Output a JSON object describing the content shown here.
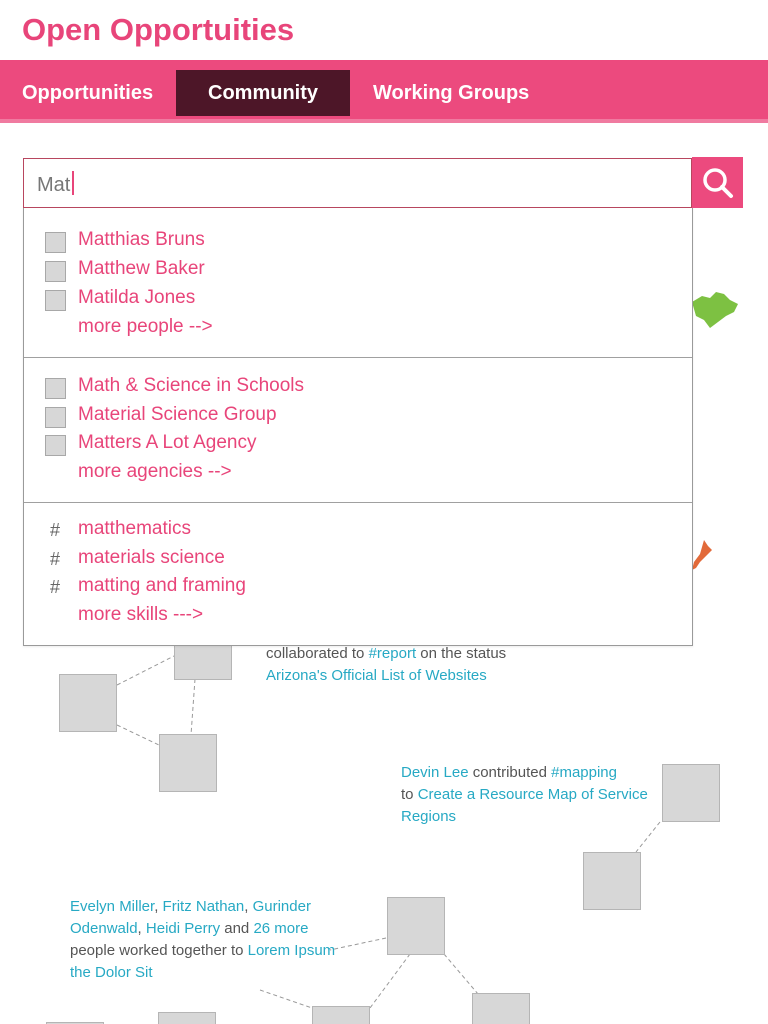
{
  "header": {
    "title": "Open Opportuities"
  },
  "nav": {
    "items": [
      {
        "label": "Opportunities",
        "active": false
      },
      {
        "label": "Community",
        "active": true
      },
      {
        "label": "Working Groups",
        "active": false
      }
    ]
  },
  "colors": {
    "brand": "#ec4a7e",
    "nav_active": "#4d1628",
    "link": "#e8457a",
    "activity_link": "#27a9c4"
  },
  "search": {
    "value": "Mat",
    "button_icon": "search-icon",
    "people": {
      "items": [
        "Matthias Bruns",
        "Matthew Baker",
        "Matilda Jones"
      ],
      "more": "more people -->"
    },
    "agencies": {
      "items": [
        "Math & Science in Schools",
        "Material Science Group",
        "Matters A Lot Agency"
      ],
      "more": "more agencies -->"
    },
    "skills": {
      "prefix": "#",
      "items": [
        "matthematics",
        "materials science",
        "matting and framing"
      ],
      "more": "more skills --->"
    }
  },
  "activity": {
    "item1": {
      "verb": "collaborated to",
      "tag": "#report",
      "rest": "on the status",
      "target": "Arizona's Official List of Websites"
    },
    "item2": {
      "actor": "Devin Lee",
      "verb": "contributed",
      "tag": "#mapping",
      "to": "to",
      "target": "Create a Resource Map of Service Regions"
    },
    "item3": {
      "p1": "Evelyn Miller",
      "sep1": ",",
      "p2": "Fritz Nathan",
      "sep2": ",",
      "p3": "Gurinder Odenwald",
      "sep3": ",",
      "p4": "Heidi Perry",
      "and": "and",
      "more": "26 more",
      "verb": "people worked together to",
      "target": "Lorem Ipsum the Dolor Sit"
    }
  }
}
